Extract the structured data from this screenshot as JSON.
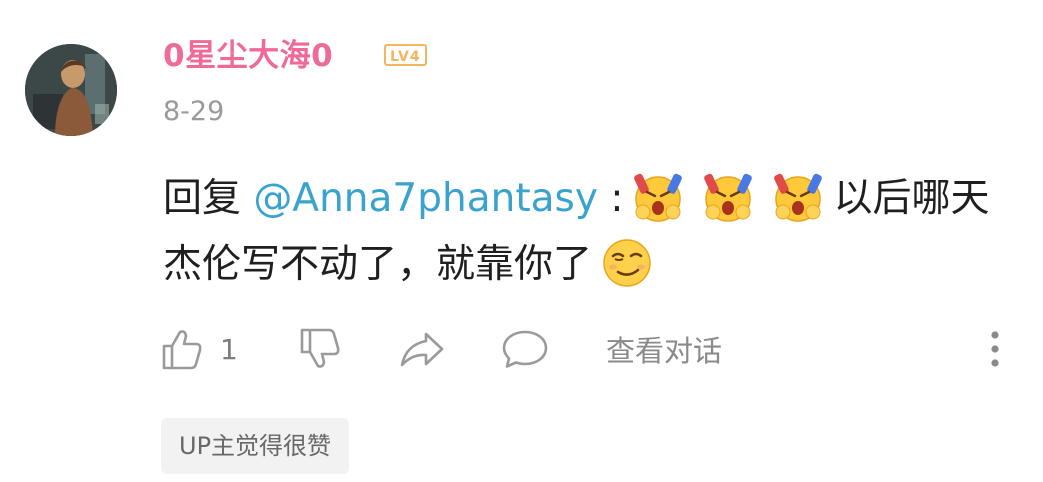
{
  "comment": {
    "username": "0星尘大海0",
    "level_badge": "LV4",
    "date": "8-29",
    "text": {
      "reply_prefix": "回复 ",
      "mention": "@Anna7phantasy",
      "separator": " :",
      "emojis_1": [
        "crying-emoji",
        "crying-emoji",
        "crying-emoji"
      ],
      "text_part_1": "以后哪天杰伦写不动了，就靠你了",
      "emoji_end": "smirk-emoji"
    },
    "actions": {
      "like_count": "1",
      "view_conversation_label": "查看对话"
    },
    "up_tag": "UP主觉得很赞"
  },
  "colors": {
    "username": "#f06a98",
    "level_badge": "#f4b55f",
    "mention": "#3aa2cf",
    "muted": "#9a9a9a"
  }
}
